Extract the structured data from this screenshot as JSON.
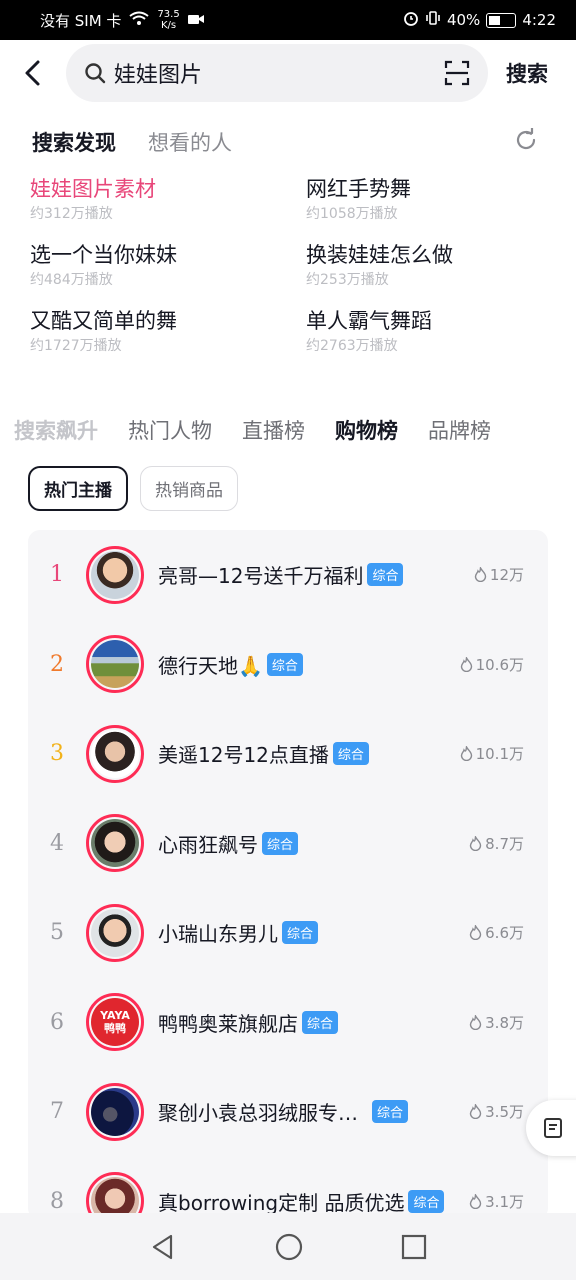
{
  "status": {
    "carrier": "没有 SIM 卡",
    "net_speed_value": "73.5",
    "net_speed_unit": "K/s",
    "battery": "40%",
    "time": "4:22"
  },
  "search": {
    "query": "娃娃图片",
    "button_label": "搜索"
  },
  "discover": {
    "tabs": [
      {
        "label": "搜索发现"
      },
      {
        "label": "想看的人"
      }
    ],
    "suggestions": [
      {
        "title": "娃娃图片素材",
        "plays": "约312万播放"
      },
      {
        "title": "网红手势舞",
        "plays": "约1058万播放"
      },
      {
        "title": "选一个当你妹妹",
        "plays": "约484万播放"
      },
      {
        "title": "换装娃娃怎么做",
        "plays": "约253万播放"
      },
      {
        "title": "又酷又简单的舞",
        "plays": "约1727万播放"
      },
      {
        "title": "单人霸气舞蹈",
        "plays": "约2763万播放"
      }
    ]
  },
  "rank_tabs": [
    {
      "label": "搜索飙升"
    },
    {
      "label": "热门人物"
    },
    {
      "label": "直播榜"
    },
    {
      "label": "购物榜"
    },
    {
      "label": "品牌榜"
    }
  ],
  "sub_tabs": [
    {
      "label": "热门主播"
    },
    {
      "label": "热销商品"
    }
  ],
  "colors": {
    "accent_pink": "#e8477a",
    "rank1": "#e8477a",
    "rank2": "#f07a2c",
    "rank3": "#f2b21a",
    "rank_other": "#9a9ba1",
    "tag_blue": "#3d9bf5",
    "avatar_ring": "#fe2c55"
  },
  "ranking": [
    {
      "rank": "1",
      "name": "亮哥—12号送千万福利",
      "tag": "综合",
      "heat": "12万"
    },
    {
      "rank": "2",
      "name": "德行天地🙏",
      "tag": "综合",
      "heat": "10.6万"
    },
    {
      "rank": "3",
      "name": "美遥12号12点直播",
      "tag": "综合",
      "heat": "10.1万"
    },
    {
      "rank": "4",
      "name": "心雨狂飙号",
      "tag": "综合",
      "heat": "8.7万"
    },
    {
      "rank": "5",
      "name": "小瑞山东男儿",
      "tag": "综合",
      "heat": "6.6万"
    },
    {
      "rank": "6",
      "name": "鸭鸭奥莱旗舰店",
      "tag": "综合",
      "heat": "3.8万",
      "avatar_text": "YAYA鸭鸭"
    },
    {
      "rank": "7",
      "name": "聚创小袁总羽绒服专…",
      "tag": "综合",
      "heat": "3.5万"
    },
    {
      "rank": "8",
      "name": "真borrowing定制 品质优选",
      "tag": "综合",
      "heat": "3.1万"
    }
  ]
}
